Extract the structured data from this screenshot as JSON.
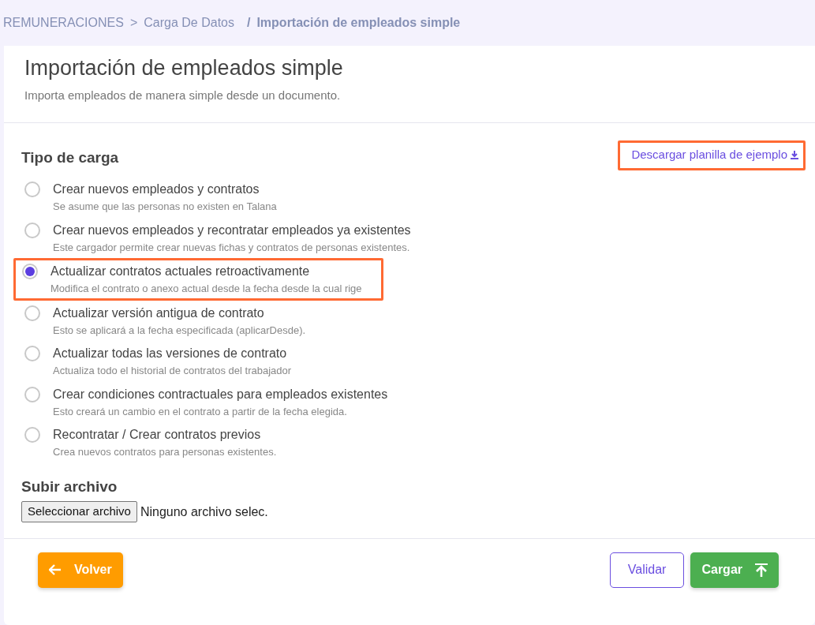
{
  "breadcrumb": [
    {
      "label": "REMUNERACIONES",
      "current": false
    },
    {
      "label": "Carga De Datos",
      "current": false
    },
    {
      "label": "Importación de empleados simple",
      "current": true
    }
  ],
  "breadcrumb_separators": [
    ">",
    "/"
  ],
  "header": {
    "title": "Importación de empleados simple",
    "subtitle": "Importa empleados de manera simple desde un documento."
  },
  "load_type": {
    "title": "Tipo de carga",
    "download_link": {
      "label": "Descargar planilla de ejemplo",
      "highlighted": true
    },
    "options": [
      {
        "label": "Crear nuevos empleados y contratos",
        "description": "Se asume que las personas no existen en Talana",
        "selected": false,
        "highlighted": false
      },
      {
        "label": "Crear nuevos empleados y recontratar empleados ya existentes",
        "description": "Este cargador permite crear nuevas fichas y contratos de personas existentes.",
        "selected": false,
        "highlighted": false
      },
      {
        "label": "Actualizar contratos actuales retroactivamente",
        "description": "Modifica el contrato o anexo actual desde la fecha desde la cual rige",
        "selected": true,
        "highlighted": true
      },
      {
        "label": "Actualizar versión antigua de contrato",
        "description": "Esto se aplicará a la fecha especificada (aplicarDesde).",
        "selected": false,
        "highlighted": false
      },
      {
        "label": "Actualizar todas las versiones de contrato",
        "description": "Actualiza todo el historial de contratos del trabajador",
        "selected": false,
        "highlighted": false
      },
      {
        "label": "Crear condiciones contractuales para empleados existentes",
        "description": "Esto creará un cambio en el contrato a partir de la fecha elegida.",
        "selected": false,
        "highlighted": false
      },
      {
        "label": "Recontratar / Crear contratos previos",
        "description": "Crea nuevos contratos para personas existentes.",
        "selected": false,
        "highlighted": false
      }
    ]
  },
  "upload": {
    "title": "Subir archivo",
    "button": "Seleccionar archivo",
    "status": "Ninguno archivo selec."
  },
  "footer": {
    "back": "Volver",
    "validate": "Validar",
    "submit": "Cargar"
  }
}
